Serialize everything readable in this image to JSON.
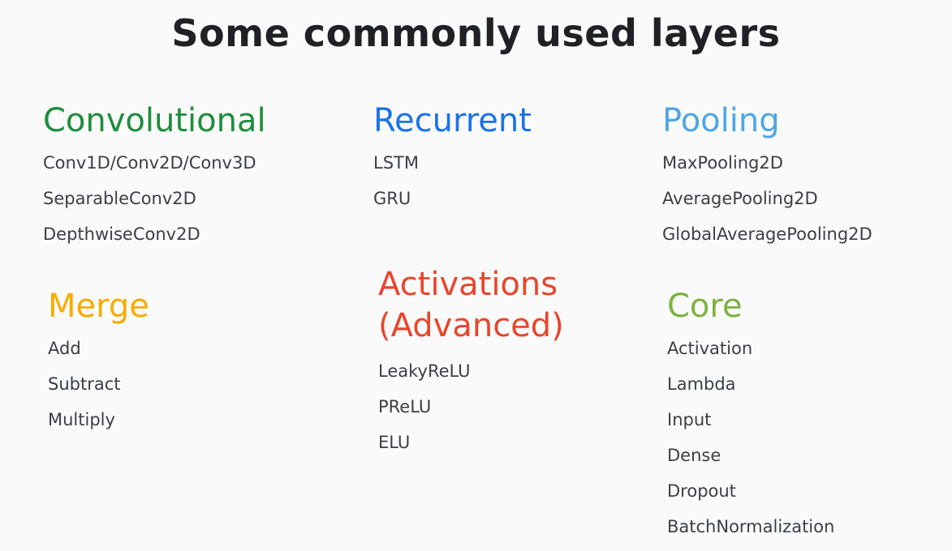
{
  "title": "Some commonly used layers",
  "groups": {
    "convolutional": {
      "title": "Convolutional",
      "items": [
        "Conv1D/Conv2D/Conv3D",
        "SeparableConv2D",
        "DepthwiseConv2D"
      ]
    },
    "recurrent": {
      "title": "Recurrent",
      "items": [
        "LSTM",
        "GRU"
      ]
    },
    "pooling": {
      "title": "Pooling",
      "items": [
        "MaxPooling2D",
        "AveragePooling2D",
        "GlobalAveragePooling2D"
      ]
    },
    "merge": {
      "title": "Merge",
      "items": [
        "Add",
        "Subtract",
        "Multiply"
      ]
    },
    "activations": {
      "title_line1": "Activations",
      "title_line2": "(Advanced)",
      "items": [
        "LeakyReLU",
        "PReLU",
        "ELU"
      ]
    },
    "core": {
      "title": "Core",
      "items": [
        "Activation",
        "Lambda",
        "Input",
        "Dense",
        "Dropout",
        "BatchNormalization"
      ]
    }
  },
  "colors": {
    "convolutional": "#1e8e3e",
    "recurrent": "#1a73e8",
    "pooling": "#4ea6e6",
    "merge": "#f9ab00",
    "activations": "#e8452c",
    "core": "#7cb342"
  }
}
